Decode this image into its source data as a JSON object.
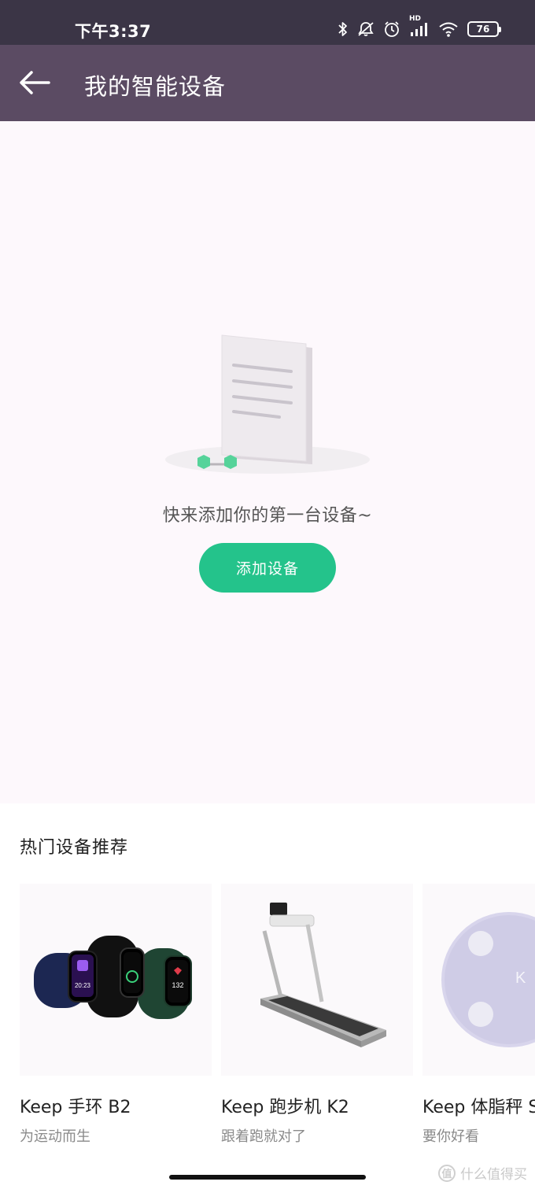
{
  "status_bar": {
    "time": "下午3:37",
    "network_label": "HD",
    "battery_level": "76",
    "icons": [
      "bluetooth-icon",
      "mute-icon",
      "alarm-icon",
      "signal-icon",
      "wifi-icon",
      "battery-icon"
    ]
  },
  "app_bar": {
    "back_icon": "back-arrow-icon",
    "title": "我的智能设备"
  },
  "empty_state": {
    "illustration": "empty-document-illustration",
    "message": "快来添加你的第一台设备~",
    "add_button_label": "添加设备"
  },
  "recommendations": {
    "title": "热门设备推荐",
    "items": [
      {
        "name": "Keep 手环 B2",
        "desc": "为运动而生",
        "image": "fitness-band-image",
        "watch_time": "20:23",
        "watch_value": "132"
      },
      {
        "name": "Keep 跑步机 K2",
        "desc": "跟着跑就对了",
        "image": "treadmill-image"
      },
      {
        "name": "Keep 体脂秤 S",
        "desc": "要你好看",
        "image": "body-fat-scale-image"
      }
    ]
  },
  "watermark": {
    "logo": "值",
    "text": "什么值得买"
  },
  "colors": {
    "status_bar": "#3b3546",
    "app_bar": "#5b4b63",
    "accent": "#24c38b",
    "background": "#fdf8fc"
  }
}
